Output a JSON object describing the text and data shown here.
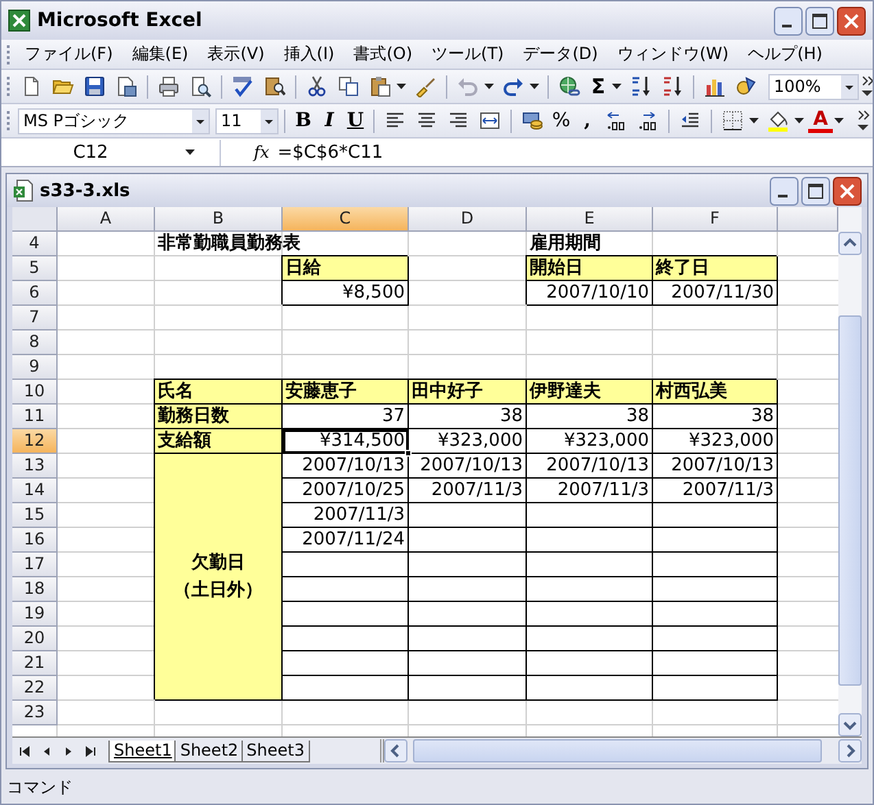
{
  "window": {
    "title": "Microsoft Excel"
  },
  "menu": [
    "ファイル(F)",
    "編集(E)",
    "表示(V)",
    "挿入(I)",
    "書式(O)",
    "ツール(T)",
    "データ(D)",
    "ウィンドウ(W)",
    "ヘルプ(H)"
  ],
  "standard_toolbar": {
    "autosum": "Σ",
    "zoom": "100%"
  },
  "formatting_toolbar": {
    "font": "MS Pゴシック",
    "size": "11",
    "bold": "B",
    "italic": "I",
    "underline": "U",
    "percent": "%",
    "comma": ",",
    "font_color": "A"
  },
  "formula_bar": {
    "name_box": "C12",
    "fx": "fx",
    "formula": "=$C$6*C11"
  },
  "workbook": {
    "title": "s33-3.xls",
    "columns": [
      {
        "label": "A",
        "selected": false
      },
      {
        "label": "B",
        "selected": false
      },
      {
        "label": "C",
        "selected": true
      },
      {
        "label": "D",
        "selected": false
      },
      {
        "label": "E",
        "selected": false
      },
      {
        "label": "F",
        "selected": false
      }
    ],
    "rows": [
      {
        "number": "4",
        "selected": false,
        "cells": [
          {
            "kind": "empty"
          },
          {
            "kind": "title",
            "text": "非常勤職員勤務表"
          },
          {
            "kind": "empty"
          },
          {
            "kind": "label",
            "text": "雇用期間"
          },
          {
            "kind": "empty"
          }
        ]
      },
      {
        "number": "5",
        "selected": false,
        "cells": [
          {
            "kind": "empty"
          },
          {
            "kind": "empty"
          },
          {
            "kind": "header",
            "text": "日給"
          },
          {
            "kind": "empty"
          },
          {
            "kind": "header",
            "text": "開始日"
          },
          {
            "kind": "header",
            "text": "終了日"
          }
        ]
      },
      {
        "number": "6",
        "selected": false,
        "cells": [
          {
            "kind": "empty"
          },
          {
            "kind": "empty"
          },
          {
            "kind": "value",
            "text": "¥8,500"
          },
          {
            "kind": "empty"
          },
          {
            "kind": "value",
            "text": "2007/10/10"
          },
          {
            "kind": "value",
            "text": "2007/11/30"
          }
        ]
      },
      {
        "number": "7",
        "selected": false,
        "cells": [
          {
            "kind": "empty"
          },
          {
            "kind": "empty"
          },
          {
            "kind": "empty"
          },
          {
            "kind": "empty"
          },
          {
            "kind": "empty"
          },
          {
            "kind": "empty"
          }
        ]
      },
      {
        "number": "8",
        "selected": false,
        "cells": [
          {
            "kind": "empty"
          },
          {
            "kind": "empty"
          },
          {
            "kind": "empty"
          },
          {
            "kind": "empty"
          },
          {
            "kind": "empty"
          },
          {
            "kind": "empty"
          }
        ]
      },
      {
        "number": "9",
        "selected": false,
        "cells": [
          {
            "kind": "empty"
          },
          {
            "kind": "empty"
          },
          {
            "kind": "empty"
          },
          {
            "kind": "empty"
          },
          {
            "kind": "empty"
          },
          {
            "kind": "empty"
          }
        ]
      },
      {
        "number": "10",
        "selected": false,
        "cells": [
          {
            "kind": "empty"
          },
          {
            "kind": "header",
            "text": "氏名"
          },
          {
            "kind": "header",
            "text": "安藤恵子"
          },
          {
            "kind": "header",
            "text": "田中好子"
          },
          {
            "kind": "header",
            "text": "伊野達夫"
          },
          {
            "kind": "header",
            "text": "村西弘美"
          }
        ]
      },
      {
        "number": "11",
        "selected": false,
        "cells": [
          {
            "kind": "empty"
          },
          {
            "kind": "header",
            "text": "勤務日数"
          },
          {
            "kind": "value",
            "text": "37"
          },
          {
            "kind": "value",
            "text": "38"
          },
          {
            "kind": "value",
            "text": "38"
          },
          {
            "kind": "value",
            "text": "38"
          }
        ]
      },
      {
        "number": "12",
        "selected": true,
        "cells": [
          {
            "kind": "empty"
          },
          {
            "kind": "header",
            "text": "支給額"
          },
          {
            "kind": "value",
            "text": "¥314,500"
          },
          {
            "kind": "value",
            "text": "¥323,000"
          },
          {
            "kind": "value",
            "text": "¥323,000"
          },
          {
            "kind": "value",
            "text": "¥323,000"
          }
        ]
      },
      {
        "number": "13",
        "selected": false,
        "cells": [
          {
            "kind": "empty"
          },
          {
            "kind": "value",
            "text": "2007/10/13"
          },
          {
            "kind": "value",
            "text": "2007/10/13"
          },
          {
            "kind": "value",
            "text": "2007/10/13"
          },
          {
            "kind": "value",
            "text": "2007/10/13"
          }
        ]
      },
      {
        "number": "14",
        "selected": false,
        "cells": [
          {
            "kind": "empty"
          },
          {
            "kind": "value",
            "text": "2007/10/25"
          },
          {
            "kind": "value",
            "text": "2007/11/3"
          },
          {
            "kind": "value",
            "text": "2007/11/3"
          },
          {
            "kind": "value",
            "text": "2007/11/3"
          }
        ]
      },
      {
        "number": "15",
        "selected": false,
        "cells": [
          {
            "kind": "empty"
          },
          {
            "kind": "value",
            "text": "2007/11/3"
          },
          {
            "kind": "box"
          },
          {
            "kind": "box"
          },
          {
            "kind": "box"
          }
        ]
      },
      {
        "number": "16",
        "selected": false,
        "cells": [
          {
            "kind": "empty"
          },
          {
            "kind": "value",
            "text": "2007/11/24"
          },
          {
            "kind": "box"
          },
          {
            "kind": "box"
          },
          {
            "kind": "box"
          }
        ]
      },
      {
        "number": "17",
        "selected": false,
        "cells": [
          {
            "kind": "empty"
          },
          {
            "kind": "box"
          },
          {
            "kind": "box"
          },
          {
            "kind": "box"
          },
          {
            "kind": "box"
          }
        ]
      },
      {
        "number": "18",
        "selected": false,
        "cells": [
          {
            "kind": "empty"
          },
          {
            "kind": "box"
          },
          {
            "kind": "box"
          },
          {
            "kind": "box"
          },
          {
            "kind": "box"
          }
        ]
      },
      {
        "number": "19",
        "selected": false,
        "cells": [
          {
            "kind": "empty"
          },
          {
            "kind": "box"
          },
          {
            "kind": "box"
          },
          {
            "kind": "box"
          },
          {
            "kind": "box"
          }
        ]
      },
      {
        "number": "20",
        "selected": false,
        "cells": [
          {
            "kind": "empty"
          },
          {
            "kind": "box"
          },
          {
            "kind": "box"
          },
          {
            "kind": "box"
          },
          {
            "kind": "box"
          }
        ]
      },
      {
        "number": "21",
        "selected": false,
        "cells": [
          {
            "kind": "empty"
          },
          {
            "kind": "box"
          },
          {
            "kind": "box"
          },
          {
            "kind": "box"
          },
          {
            "kind": "box"
          }
        ]
      },
      {
        "number": "22",
        "selected": false,
        "cells": [
          {
            "kind": "empty"
          },
          {
            "kind": "box"
          },
          {
            "kind": "box"
          },
          {
            "kind": "box"
          },
          {
            "kind": "box"
          }
        ]
      },
      {
        "number": "23",
        "selected": false,
        "cells": [
          {
            "kind": "empty"
          },
          {
            "kind": "empty"
          },
          {
            "kind": "empty"
          },
          {
            "kind": "empty"
          },
          {
            "kind": "empty"
          },
          {
            "kind": "empty"
          }
        ]
      }
    ],
    "absence_block": {
      "label_lines": [
        "欠勤日",
        "（土日外）"
      ]
    }
  },
  "sheet_tabs": [
    {
      "label": "Sheet1",
      "selected": true
    },
    {
      "label": "Sheet2",
      "selected": false
    },
    {
      "label": "Sheet3",
      "selected": false
    }
  ],
  "status_bar": {
    "mode": "コマンド"
  }
}
